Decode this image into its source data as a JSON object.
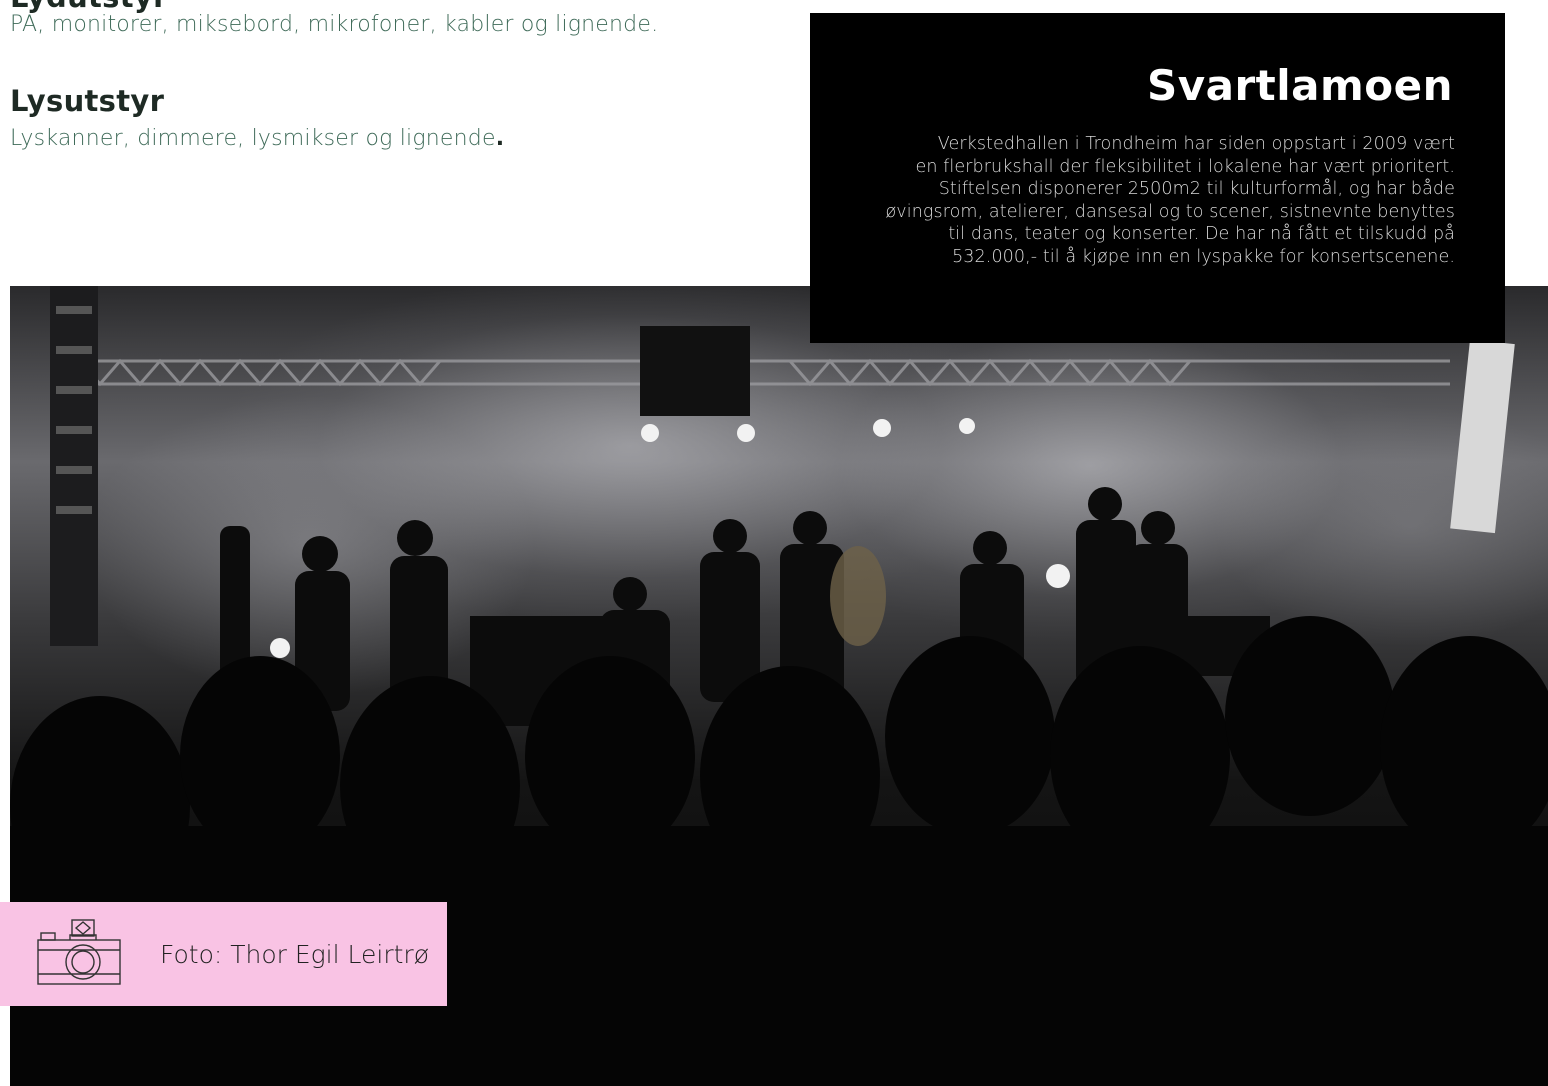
{
  "equipment": {
    "sound": {
      "title": "Lydutstyr",
      "description": "PA, monitorer, miksebord, mikrofoner, kabler og lignende."
    },
    "light": {
      "title": "Lysutstyr",
      "description": "Lyskanner, dimmere, lysmikser og lignende",
      "description_end": "."
    }
  },
  "info": {
    "title": "Svartlamoen",
    "lines": [
      "Verkstedhallen i Trondheim har siden oppstart i 2009 vært",
      "en flerbrukshall der fleksibilitet i lokalene har vært prioritert.",
      "Stiftelsen disponerer 2500m2 til kulturformål, og har både",
      "øvingsrom, atelierer, dansesal og to scener, sistnevnte benyttes",
      "til dans, teater og konserter. De har nå fått et tilskudd på",
      "532.000,- til å kjøpe inn en lyspakke for konsertscenene."
    ]
  },
  "photo": {
    "credit": "Foto: Thor Egil Leirtrø",
    "credit_icon": "camera-icon"
  },
  "colors": {
    "heading": "#1e2a24",
    "description": "#3e6a58",
    "info_background": "#000000",
    "caption_background": "#f9c3e4"
  }
}
